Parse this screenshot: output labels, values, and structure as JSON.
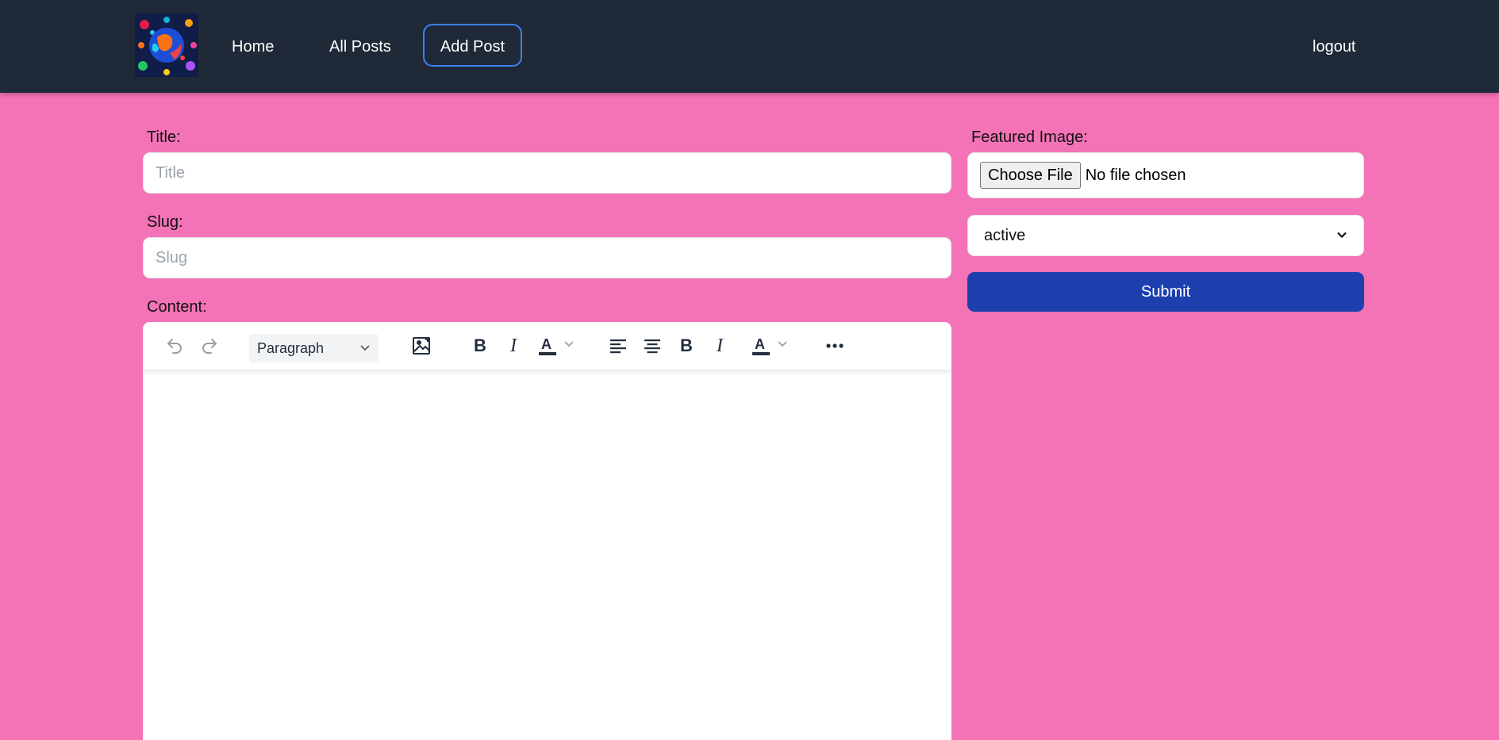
{
  "header": {
    "logo_alt": "site logo",
    "nav": {
      "home": "Home",
      "all_posts": "All Posts",
      "add_post": "Add Post",
      "logout": "logout"
    }
  },
  "form": {
    "title_label": "Title:",
    "title_placeholder": "Title",
    "slug_label": "Slug:",
    "slug_placeholder": "Slug",
    "content_label": "Content:",
    "editor": {
      "block_format": "Paragraph",
      "tools": [
        "undo-icon",
        "redo-icon",
        "image-icon",
        "bold-icon",
        "italic-icon",
        "text-color-icon",
        "align-left-icon",
        "align-center-icon",
        "bold-icon",
        "italic-icon",
        "text-color-icon",
        "more-icon"
      ],
      "bold_glyph": "B",
      "italic_glyph": "I",
      "color_glyph": "A",
      "more_glyph": "•••"
    },
    "featured_image_label": "Featured Image:",
    "file_button": "Choose File",
    "file_status": "No file chosen",
    "status_value": "active",
    "submit_label": "Submit"
  },
  "colors": {
    "page_bg": "#f472b6",
    "header_bg": "#1f2937",
    "active_border": "#3b82f6",
    "submit_bg": "#1e40af"
  }
}
